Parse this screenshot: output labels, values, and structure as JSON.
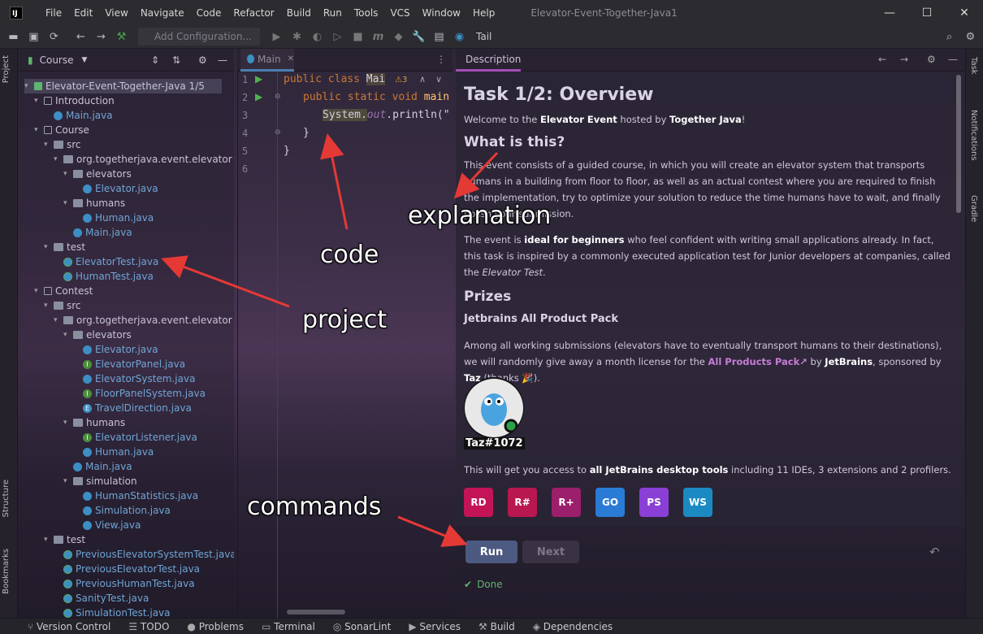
{
  "titlebar": {
    "logo": "IJ",
    "menu": [
      "File",
      "Edit",
      "View",
      "Navigate",
      "Code",
      "Refactor",
      "Build",
      "Run",
      "Tools",
      "VCS",
      "Window",
      "Help"
    ],
    "title": "Elevator-Event-Together-Java1",
    "min": "—",
    "max": "☐",
    "close": "✕"
  },
  "toolbar": {
    "add_config": "Add Configuration...",
    "tail": "Tail"
  },
  "left_strip": {
    "project": "Project",
    "structure": "Structure",
    "bookmarks": "Bookmarks"
  },
  "right_strip": {
    "task": "Task",
    "notifications": "Notifications",
    "gradle": "Gradle"
  },
  "project": {
    "header": "Course",
    "rows": [
      {
        "label": "Elevator-Event-Together-Java  1/5",
        "indent": 0,
        "icon": "course",
        "tw": "▾"
      },
      {
        "label": "Introduction",
        "indent": 1,
        "icon": "mod",
        "tw": "▾"
      },
      {
        "label": "Main.java",
        "indent": 2,
        "icon": "c",
        "tw": ""
      },
      {
        "label": "Course",
        "indent": 1,
        "icon": "mod",
        "tw": "▾"
      },
      {
        "label": "src",
        "indent": 2,
        "icon": "dir",
        "tw": "▾"
      },
      {
        "label": "org.togetherjava.event.elevator",
        "indent": 3,
        "icon": "dir",
        "tw": "▾"
      },
      {
        "label": "elevators",
        "indent": 4,
        "icon": "dir",
        "tw": "▾"
      },
      {
        "label": "Elevator.java",
        "indent": 5,
        "icon": "c",
        "tw": ""
      },
      {
        "label": "humans",
        "indent": 4,
        "icon": "dir",
        "tw": "▾"
      },
      {
        "label": "Human.java",
        "indent": 5,
        "icon": "c",
        "tw": ""
      },
      {
        "label": "Main.java",
        "indent": 4,
        "icon": "c",
        "tw": ""
      },
      {
        "label": "test",
        "indent": 2,
        "icon": "dir",
        "tw": "▾"
      },
      {
        "label": "ElevatorTest.java",
        "indent": 3,
        "icon": "t",
        "tw": ""
      },
      {
        "label": "HumanTest.java",
        "indent": 3,
        "icon": "t",
        "tw": ""
      },
      {
        "label": "Contest",
        "indent": 1,
        "icon": "mod",
        "tw": "▾"
      },
      {
        "label": "src",
        "indent": 2,
        "icon": "dir",
        "tw": "▾"
      },
      {
        "label": "org.togetherjava.event.elevator",
        "indent": 3,
        "icon": "dir",
        "tw": "▾"
      },
      {
        "label": "elevators",
        "indent": 4,
        "icon": "dir",
        "tw": "▾"
      },
      {
        "label": "Elevator.java",
        "indent": 5,
        "icon": "c",
        "tw": ""
      },
      {
        "label": "ElevatorPanel.java",
        "indent": 5,
        "icon": "i",
        "tw": ""
      },
      {
        "label": "ElevatorSystem.java",
        "indent": 5,
        "icon": "c",
        "tw": ""
      },
      {
        "label": "FloorPanelSystem.java",
        "indent": 5,
        "icon": "i",
        "tw": ""
      },
      {
        "label": "TravelDirection.java",
        "indent": 5,
        "icon": "e",
        "tw": ""
      },
      {
        "label": "humans",
        "indent": 4,
        "icon": "dir",
        "tw": "▾"
      },
      {
        "label": "ElevatorListener.java",
        "indent": 5,
        "icon": "i",
        "tw": ""
      },
      {
        "label": "Human.java",
        "indent": 5,
        "icon": "c",
        "tw": ""
      },
      {
        "label": "Main.java",
        "indent": 4,
        "icon": "c",
        "tw": ""
      },
      {
        "label": "simulation",
        "indent": 4,
        "icon": "dir",
        "tw": "▾"
      },
      {
        "label": "HumanStatistics.java",
        "indent": 5,
        "icon": "c",
        "tw": ""
      },
      {
        "label": "Simulation.java",
        "indent": 5,
        "icon": "c",
        "tw": ""
      },
      {
        "label": "View.java",
        "indent": 5,
        "icon": "c",
        "tw": ""
      },
      {
        "label": "test",
        "indent": 2,
        "icon": "dir",
        "tw": "▾"
      },
      {
        "label": "PreviousElevatorSystemTest.java",
        "indent": 3,
        "icon": "t",
        "tw": ""
      },
      {
        "label": "PreviousElevatorTest.java",
        "indent": 3,
        "icon": "t",
        "tw": ""
      },
      {
        "label": "PreviousHumanTest.java",
        "indent": 3,
        "icon": "t",
        "tw": ""
      },
      {
        "label": "SanityTest.java",
        "indent": 3,
        "icon": "t",
        "tw": ""
      },
      {
        "label": "SimulationTest.java",
        "indent": 3,
        "icon": "t",
        "tw": ""
      }
    ]
  },
  "editor": {
    "tab": "Main",
    "warn": "⚠3",
    "line_numbers": [
      "1",
      "2",
      "3",
      "4",
      "5",
      "6"
    ],
    "l1_kw": "public class ",
    "l1_name": "Mai",
    "l2_kw": "public static void ",
    "l2_name": "main",
    "l3_sys": "System.",
    "l3_out": "out",
    "l3_rest": ".println(\"",
    "l4": "}",
    "l5": "}"
  },
  "description": {
    "tab": "Description",
    "title": "Task 1/2: Overview",
    "welcome_pre": "Welcome to the ",
    "welcome_b1": "Elevator Event",
    "welcome_mid": " hosted by ",
    "welcome_b2": "Together Java",
    "welcome_post": "!",
    "h_what": "What is this?",
    "what_text": "This event consists of a guided course, in which you will create an elevator system that transports humans in a building from floor to floor, as well as an actual contest where you are required to finish the implementation, try to optimize your solution to reduce the time humans have to wait, and finally polish your submission.",
    "beg_pre": "The event is ",
    "beg_b": "ideal for beginners",
    "beg_post": " who feel confident with writing small applications already. In fact, this task is inspired by a commonly executed application test for Junior developers at companies, called the ",
    "beg_em": "Elevator Test",
    "beg_end": ".",
    "h_prizes": "Prizes",
    "h_pack": "Jetbrains All Product Pack",
    "prize_pre": "Among all working submissions (elevators have to eventually transport humans to their destinations), we will randomly give away a month license for the ",
    "prize_link": "All Products Pack↗",
    "prize_mid": " by ",
    "prize_b": "JetBrains",
    "prize_mid2": ", sponsored by ",
    "prize_b2": "Taz",
    "prize_post": " (thanks 🎉).",
    "taz": "Taz#1072",
    "access_pre": "This will get you access to ",
    "access_b": "all JetBrains desktop tools",
    "access_post": " including 11 IDEs, 3 extensions and 2 profilers.",
    "badges": [
      {
        "t": "RD",
        "c": "#c21456"
      },
      {
        "t": "R#",
        "c": "#b9174f"
      },
      {
        "t": "R+",
        "c": "#9b1f6b"
      },
      {
        "t": "GO",
        "c": "#2a7bd6"
      },
      {
        "t": "PS",
        "c": "#8a3fd6"
      },
      {
        "t": "WS",
        "c": "#1b8ac2"
      }
    ],
    "run": "Run",
    "next": "Next",
    "done": "Done"
  },
  "statusbar": [
    "Version Control",
    "TODO",
    "Problems",
    "Terminal",
    "SonarLint",
    "Services",
    "Build",
    "Dependencies"
  ],
  "annotations": {
    "code": "code",
    "explanation": "explanation",
    "project": "project",
    "commands": "commands"
  }
}
